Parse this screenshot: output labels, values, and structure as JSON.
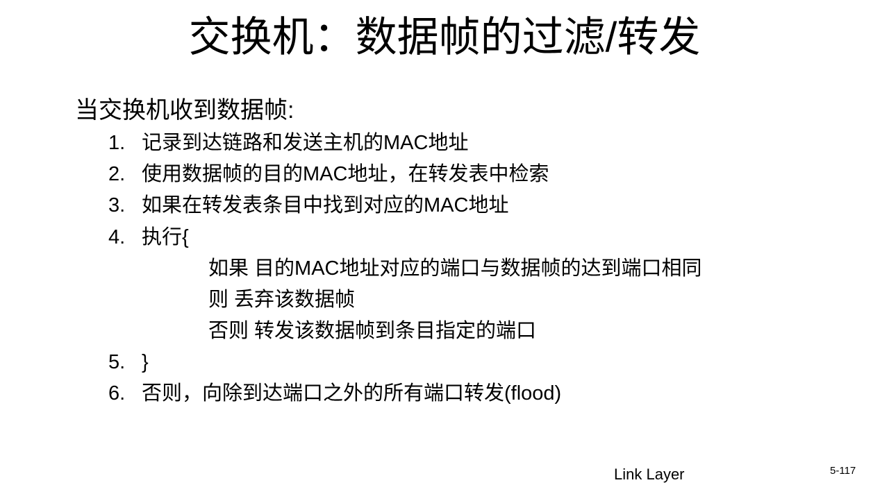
{
  "slide": {
    "title": "交换机：数据帧的过滤/转发",
    "intro": "当交换机收到数据帧:",
    "steps": [
      {
        "num": "1.",
        "text": "记录到达链路和发送主机的MAC地址"
      },
      {
        "num": "2.",
        "text": "使用数据帧的目的MAC地址，在转发表中检索"
      },
      {
        "num": "3.",
        "text": "如果在转发表条目中找到对应的MAC地址"
      },
      {
        "num": "4.",
        "text": "执行{"
      },
      {
        "num": "5.",
        "text": "}"
      },
      {
        "num": "6.",
        "text": "否则，向除到达端口之外的所有端口转发(flood)"
      }
    ],
    "sub_lines": [
      "如果 目的MAC地址对应的端口与数据帧的达到端口相同",
      "则 丢弃该数据帧",
      "否则 转发该数据帧到条目指定的端口"
    ],
    "footer": "Link Layer",
    "page_number": "5-117"
  }
}
